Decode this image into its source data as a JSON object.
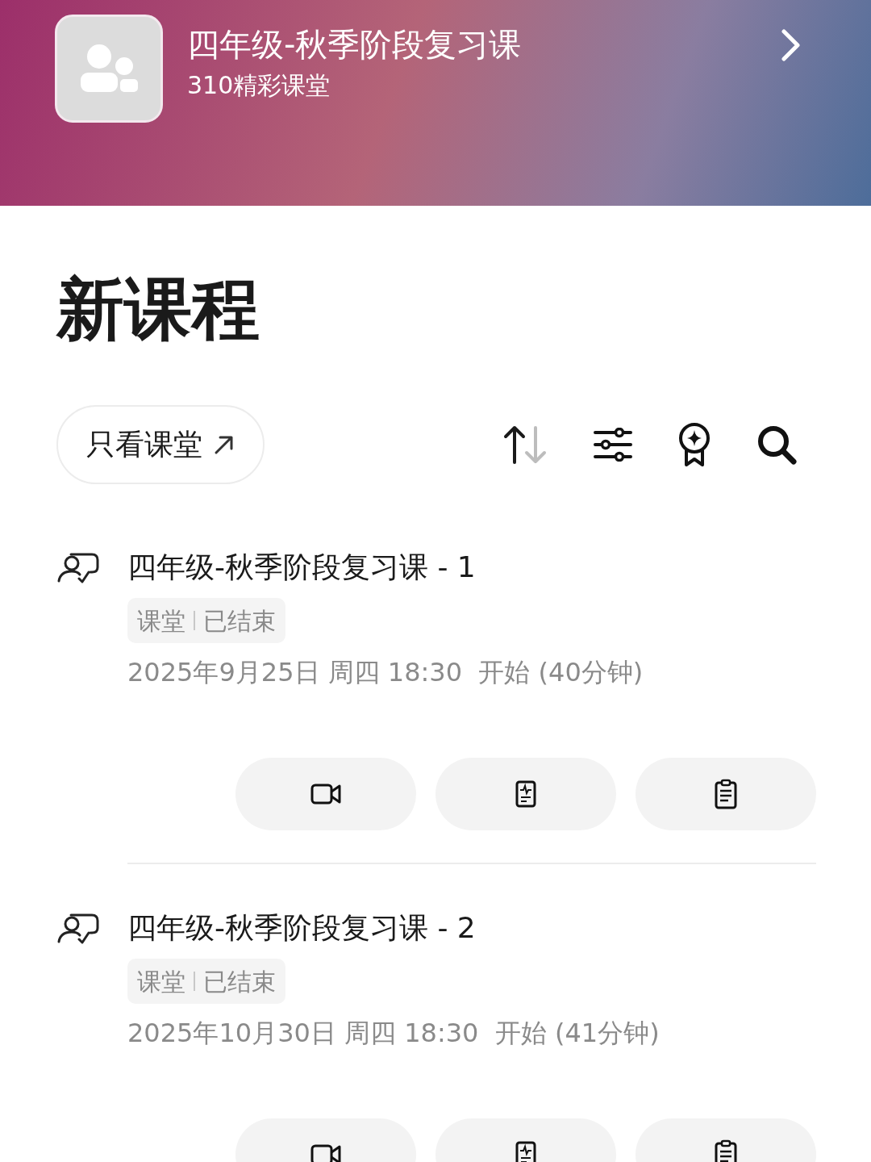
{
  "header": {
    "title": "四年级-秋季阶段复习课",
    "subtitle": "310精彩课堂"
  },
  "section_title": "新课程",
  "filter_button": {
    "label": "只看课堂"
  },
  "courses": [
    {
      "title": "四年级-秋季阶段复习课 - 1",
      "tag_type": "课堂",
      "tag_status": "已结束",
      "schedule": "2025年9月25日 周四 18:30  开始 (40分钟)"
    },
    {
      "title": "四年级-秋季阶段复习课 - 2",
      "tag_type": "课堂",
      "tag_status": "已结束",
      "schedule": "2025年10月30日 周四 18:30  开始 (41分钟)"
    }
  ]
}
